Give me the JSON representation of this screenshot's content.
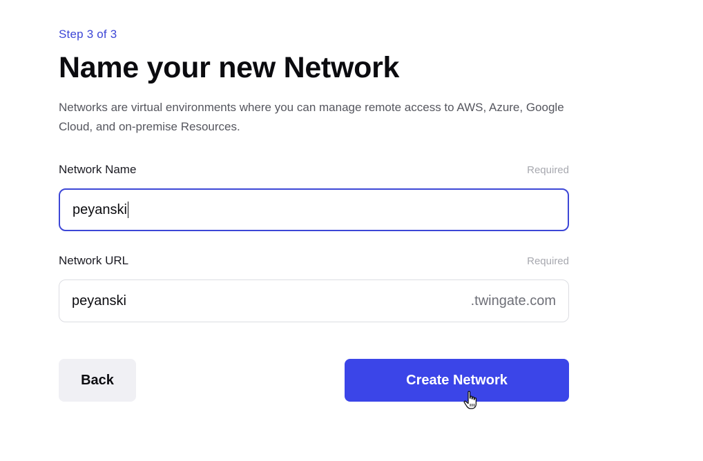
{
  "step_label": "Step 3 of 3",
  "title": "Name your new Network",
  "description": "Networks are virtual environments where you can manage remote access to AWS, Azure, Google Cloud, and on-premise Resources.",
  "network_name": {
    "label": "Network Name",
    "required_text": "Required",
    "value": "peyanski"
  },
  "network_url": {
    "label": "Network URL",
    "required_text": "Required",
    "value": "peyanski",
    "suffix": ".twingate.com"
  },
  "buttons": {
    "back_label": "Back",
    "create_label": "Create Network"
  },
  "colors": {
    "accent": "#3b45e8",
    "step_text": "#3c46d6"
  },
  "cursor_icon": "hand-pointer-icon"
}
